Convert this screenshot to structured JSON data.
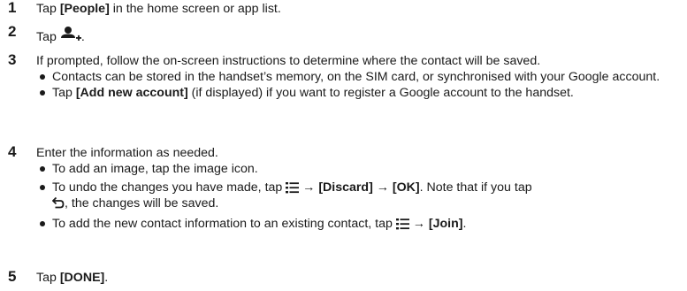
{
  "steps": [
    {
      "num": "1",
      "prefix": "Tap ",
      "bold": "[People]",
      "suffix": " in the home screen or app list."
    },
    {
      "num": "2",
      "prefix": "Tap ",
      "icon": "add-person-icon",
      "suffix": "."
    },
    {
      "num": "3",
      "text": "If prompted, follow the on-screen instructions to determine where the contact will be saved.",
      "bullets": [
        {
          "text": "Contacts can be stored in the handset’s memory, on the SIM card, or synchronised with your Google account."
        },
        {
          "prefix": "Tap ",
          "bold": "[Add new account]",
          "suffix": " (if displayed) if you want to register a Google account to the handset."
        }
      ]
    },
    {
      "num": "4",
      "text": "Enter the information as needed.",
      "bullets": [
        {
          "text": "To add an image, tap the image icon."
        },
        {
          "prefix": "To undo the changes you have made, tap ",
          "menu_icon": "menu-icon",
          "arrow1": " → ",
          "bold1": "[Discard]",
          "arrow2": " → ",
          "bold2": "[OK]",
          "mid": ". Note that if you tap",
          "back_icon": "back-icon",
          "suffix": ", the changes will be saved."
        },
        {
          "prefix": "To add the new contact information to an existing contact, tap ",
          "menu_icon": "menu-icon",
          "arrow": " → ",
          "bold": "[Join]",
          "suffix": "."
        }
      ]
    },
    {
      "num": "5",
      "prefix": "Tap ",
      "bold": "[DONE]",
      "suffix": "."
    }
  ]
}
